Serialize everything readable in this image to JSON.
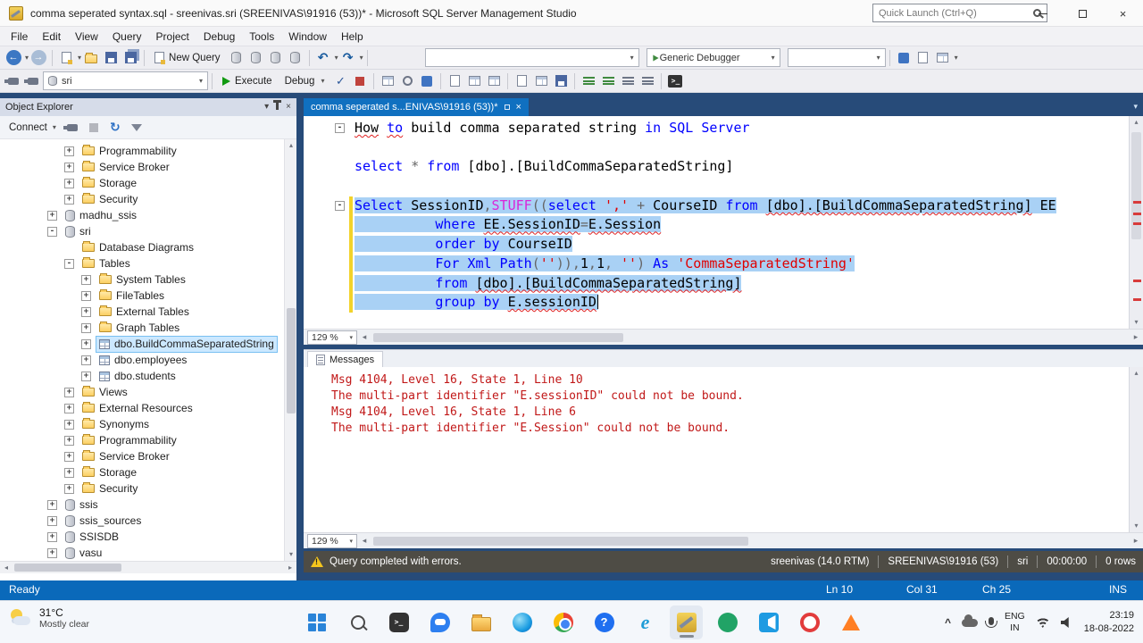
{
  "window": {
    "title": "comma seperated syntax.sql - sreenivas.sri (SREENIVAS\\91916 (53))* - Microsoft SQL Server Management Studio",
    "quick_launch_placeholder": "Quick Launch (Ctrl+Q)"
  },
  "menu": {
    "items": [
      "File",
      "Edit",
      "View",
      "Query",
      "Project",
      "Debug",
      "Tools",
      "Window",
      "Help"
    ]
  },
  "toolbars": {
    "new_query_label": "New Query",
    "debugger_combo": "Generic Debugger",
    "database_combo": "sri",
    "execute_label": "Execute",
    "debug_label": "Debug"
  },
  "object_explorer": {
    "title": "Object Explorer",
    "connect_label": "Connect",
    "tree": [
      {
        "label": "Programmability",
        "depth": 2,
        "expand": "+",
        "icon": "folder"
      },
      {
        "label": "Service Broker",
        "depth": 2,
        "expand": "+",
        "icon": "folder"
      },
      {
        "label": "Storage",
        "depth": 2,
        "expand": "+",
        "icon": "folder"
      },
      {
        "label": "Security",
        "depth": 2,
        "expand": "+",
        "icon": "folder"
      },
      {
        "label": "madhu_ssis",
        "depth": 1,
        "expand": "+",
        "icon": "db"
      },
      {
        "label": "sri",
        "depth": 1,
        "expand": "-",
        "icon": "db"
      },
      {
        "label": "Database Diagrams",
        "depth": 2,
        "expand": "",
        "icon": "folder"
      },
      {
        "label": "Tables",
        "depth": 2,
        "expand": "-",
        "icon": "folder"
      },
      {
        "label": "System Tables",
        "depth": 3,
        "expand": "+",
        "icon": "folder"
      },
      {
        "label": "FileTables",
        "depth": 3,
        "expand": "+",
        "icon": "folder"
      },
      {
        "label": "External Tables",
        "depth": 3,
        "expand": "+",
        "icon": "folder"
      },
      {
        "label": "Graph Tables",
        "depth": 3,
        "expand": "+",
        "icon": "folder"
      },
      {
        "label": "dbo.BuildCommaSeparatedString",
        "depth": 3,
        "expand": "+",
        "icon": "table",
        "selected": true
      },
      {
        "label": "dbo.employees",
        "depth": 3,
        "expand": "+",
        "icon": "table"
      },
      {
        "label": "dbo.students",
        "depth": 3,
        "expand": "+",
        "icon": "table"
      },
      {
        "label": "Views",
        "depth": 2,
        "expand": "+",
        "icon": "folder"
      },
      {
        "label": "External Resources",
        "depth": 2,
        "expand": "+",
        "icon": "folder"
      },
      {
        "label": "Synonyms",
        "depth": 2,
        "expand": "+",
        "icon": "folder"
      },
      {
        "label": "Programmability",
        "depth": 2,
        "expand": "+",
        "icon": "folder"
      },
      {
        "label": "Service Broker",
        "depth": 2,
        "expand": "+",
        "icon": "folder"
      },
      {
        "label": "Storage",
        "depth": 2,
        "expand": "+",
        "icon": "folder"
      },
      {
        "label": "Security",
        "depth": 2,
        "expand": "+",
        "icon": "folder"
      },
      {
        "label": "ssis",
        "depth": 1,
        "expand": "+",
        "icon": "db"
      },
      {
        "label": "ssis_sources",
        "depth": 1,
        "expand": "+",
        "icon": "db"
      },
      {
        "label": "SSISDB",
        "depth": 1,
        "expand": "+",
        "icon": "db"
      },
      {
        "label": "vasu",
        "depth": 1,
        "expand": "+",
        "icon": "db"
      }
    ]
  },
  "editor": {
    "tab_label": "comma seperated s...ENIVAS\\91916 (53))*",
    "zoom": "129 %",
    "code_lines": [
      {
        "fold": "-",
        "tokens": [
          {
            "t": "How",
            "c": "i",
            "u": true
          },
          {
            "t": " ",
            "c": "i"
          },
          {
            "t": "to",
            "c": "k",
            "u": true
          },
          {
            "t": " build comma separated string ",
            "c": "i"
          },
          {
            "t": "in",
            "c": "k"
          },
          {
            "t": " ",
            "c": "i"
          },
          {
            "t": "SQL Server",
            "c": "k"
          }
        ]
      },
      {
        "tokens": []
      },
      {
        "tokens": [
          {
            "t": "select",
            "c": "k"
          },
          {
            "t": " ",
            "c": "i"
          },
          {
            "t": "*",
            "c": "o"
          },
          {
            "t": " ",
            "c": "i"
          },
          {
            "t": "from",
            "c": "k"
          },
          {
            "t": " [dbo].[BuildCommaSeparatedString]",
            "c": "i"
          }
        ]
      },
      {
        "tokens": []
      },
      {
        "fold": "-",
        "bar": true,
        "sel": true,
        "tokens": [
          {
            "t": "Select",
            "c": "k"
          },
          {
            "t": " SessionID",
            "c": "i"
          },
          {
            "t": ",",
            "c": "o"
          },
          {
            "t": "STUFF",
            "c": "f"
          },
          {
            "t": "((",
            "c": "o"
          },
          {
            "t": "select",
            "c": "k"
          },
          {
            "t": " ",
            "c": "i"
          },
          {
            "t": "','",
            "c": "s"
          },
          {
            "t": " ",
            "c": "i"
          },
          {
            "t": "+",
            "c": "o"
          },
          {
            "t": " CourseID ",
            "c": "i"
          },
          {
            "t": "from",
            "c": "k"
          },
          {
            "t": " ",
            "c": "i"
          },
          {
            "t": "[dbo].[BuildCommaSeparatedString]",
            "c": "i",
            "u": true
          },
          {
            "t": " EE",
            "c": "i"
          }
        ]
      },
      {
        "bar": true,
        "sel": true,
        "tokens": [
          {
            "t": "          ",
            "c": "i"
          },
          {
            "t": "where",
            "c": "k"
          },
          {
            "t": " ",
            "c": "i"
          },
          {
            "t": "EE.SessionID",
            "c": "i",
            "u": true
          },
          {
            "t": "=",
            "c": "o"
          },
          {
            "t": "E.Session",
            "c": "i",
            "u": true
          }
        ]
      },
      {
        "bar": true,
        "sel": true,
        "tokens": [
          {
            "t": "          ",
            "c": "i"
          },
          {
            "t": "order by",
            "c": "k"
          },
          {
            "t": " CourseID",
            "c": "i"
          }
        ]
      },
      {
        "bar": true,
        "sel": true,
        "tokens": [
          {
            "t": "          ",
            "c": "i"
          },
          {
            "t": "For Xml Path",
            "c": "k"
          },
          {
            "t": "(",
            "c": "o"
          },
          {
            "t": "''",
            "c": "s"
          },
          {
            "t": ")),",
            "c": "o"
          },
          {
            "t": "1",
            "c": "n"
          },
          {
            "t": ",",
            "c": "o"
          },
          {
            "t": "1",
            "c": "n"
          },
          {
            "t": ", ",
            "c": "o"
          },
          {
            "t": "''",
            "c": "s"
          },
          {
            "t": ")",
            "c": "o"
          },
          {
            "t": " ",
            "c": "i"
          },
          {
            "t": "As",
            "c": "k"
          },
          {
            "t": " ",
            "c": "i"
          },
          {
            "t": "'CommaSeparatedString'",
            "c": "s"
          }
        ]
      },
      {
        "bar": true,
        "sel": true,
        "tokens": [
          {
            "t": "          ",
            "c": "i"
          },
          {
            "t": "from",
            "c": "k"
          },
          {
            "t": " ",
            "c": "i"
          },
          {
            "t": "[dbo].[BuildCommaSeparatedString]",
            "c": "i",
            "u": true
          }
        ]
      },
      {
        "bar": true,
        "sel": true,
        "caret": true,
        "tokens": [
          {
            "t": "          ",
            "c": "i"
          },
          {
            "t": "group by",
            "c": "k"
          },
          {
            "t": " ",
            "c": "i"
          },
          {
            "t": "E.sessionID",
            "c": "i",
            "u": true
          }
        ]
      }
    ]
  },
  "messages": {
    "tab_label": "Messages",
    "zoom": "129 %",
    "lines": [
      "Msg 4104, Level 16, State 1, Line 10",
      "The multi-part identifier \"E.sessionID\" could not be bound.",
      "Msg 4104, Level 16, State 1, Line 6",
      "The multi-part identifier \"E.Session\" could not be bound."
    ]
  },
  "query_status": {
    "message": "Query completed with errors.",
    "server": "sreenivas (14.0 RTM)",
    "user": "SREENIVAS\\91916 (53)",
    "database": "sri",
    "elapsed": "00:00:00",
    "rows": "0 rows"
  },
  "status_bar": {
    "state": "Ready",
    "line": "Ln 10",
    "column": "Col 31",
    "char": "Ch 25",
    "mode": "INS"
  },
  "taskbar": {
    "weather": {
      "temp": "31°C",
      "condition": "Mostly clear"
    },
    "language": {
      "line1": "ENG",
      "line2": "IN"
    },
    "clock": {
      "time": "23:19",
      "date": "18-08-2022"
    }
  },
  "colors": {
    "accent_blue": "#0a69ba",
    "selection_blue": "#a9d1f5",
    "keyword_blue": "#0000ff",
    "string_red": "#e00000",
    "error_red": "#c11818",
    "warning_yellow": "#f5c61d"
  }
}
